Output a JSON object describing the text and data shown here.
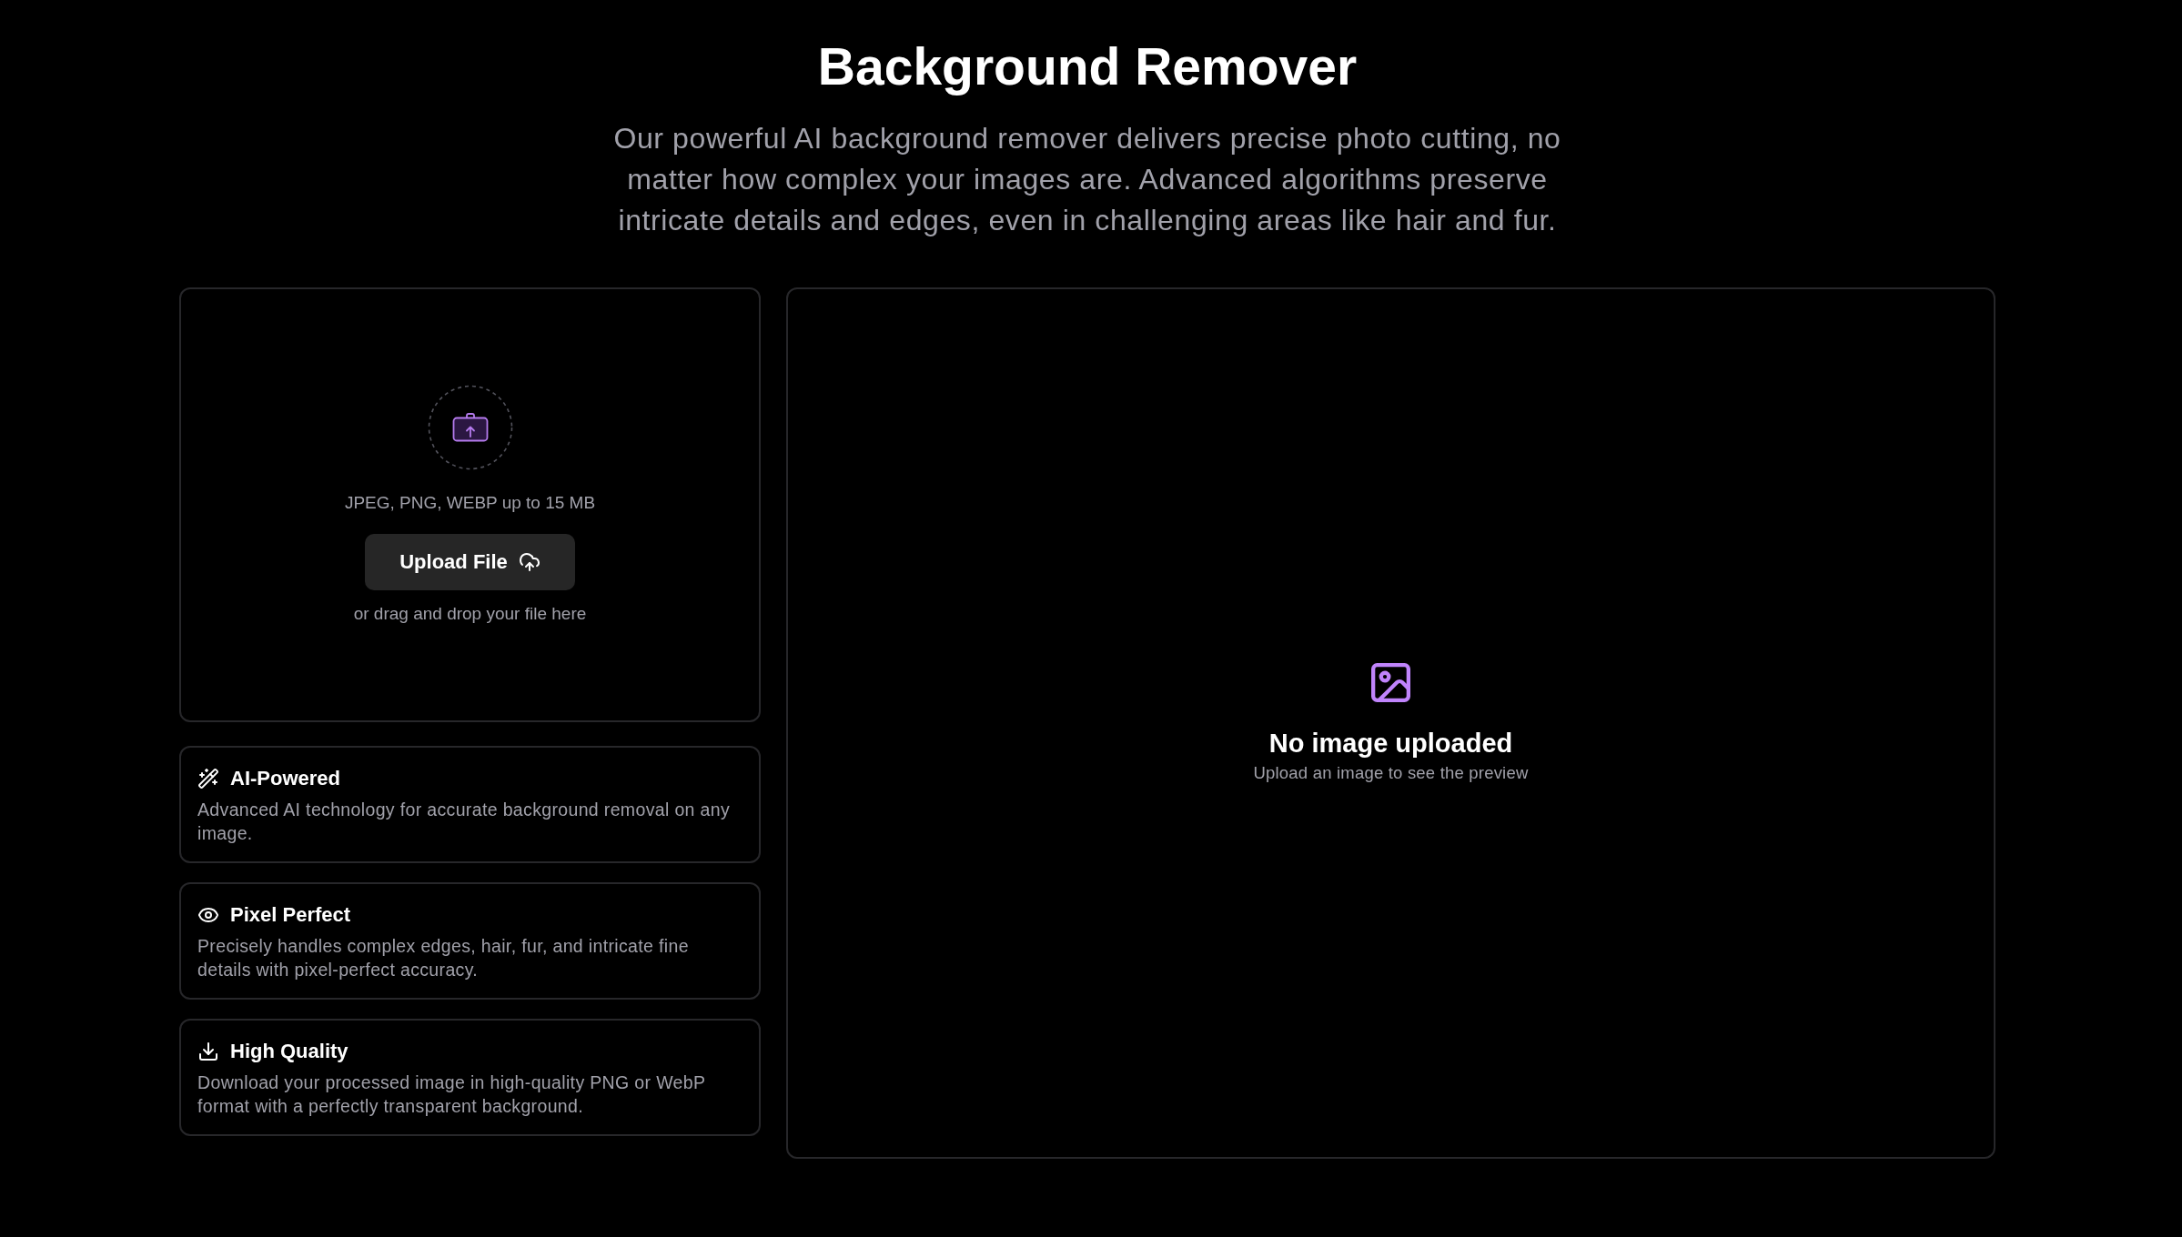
{
  "header": {
    "title": "Background Remover",
    "subtitle": "Our powerful AI background remover delivers precise photo cutting, no matter how complex your images are. Advanced algorithms preserve intricate details and edges, even in challenging areas like hair and fur."
  },
  "upload": {
    "formats": "JPEG, PNG, WEBP up to 15 MB",
    "button": "Upload File",
    "drop_hint": "or drag and drop your file here"
  },
  "features": [
    {
      "title": "AI-Powered",
      "description": "Advanced AI technology for accurate background removal on any image."
    },
    {
      "title": "Pixel Perfect",
      "description": "Precisely handles complex edges, hair, fur, and intricate fine details with pixel-perfect accuracy."
    },
    {
      "title": "High Quality",
      "description": "Download your processed image in high-quality PNG or WebP format with a perfectly transparent background."
    }
  ],
  "preview": {
    "title": "No image uploaded",
    "hint": "Upload an image to see the preview"
  }
}
